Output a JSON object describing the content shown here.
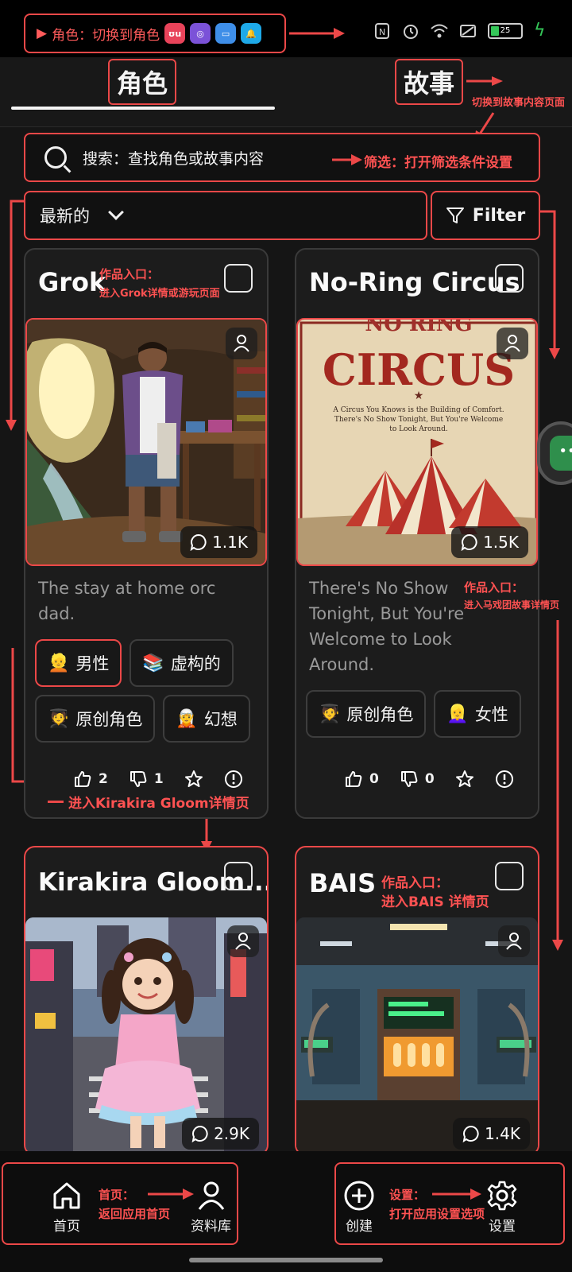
{
  "status_bar": {
    "annotation": "角色：切换到角色",
    "battery_level": "25",
    "colors": {
      "annotation_red": "#ec4848",
      "battery_green": "#35c759"
    },
    "mini_apps": [
      {
        "icon": "app-red-icon",
        "color": "#e8435a",
        "text": "ʊu"
      },
      {
        "icon": "app-purple-icon",
        "color": "#7b52d8",
        "text": "◎"
      },
      {
        "icon": "app-wallet-icon",
        "color": "#3e8ee8",
        "text": "▭"
      },
      {
        "icon": "qq-icon",
        "color": "#1ea9e8",
        "text": "🔔"
      }
    ]
  },
  "tabs": {
    "characters": "角色",
    "stories": "故事",
    "stories_annotation": "切换到故事内容页面"
  },
  "search": {
    "placeholder": "搜索：查找角色或故事内容",
    "annotation": "筛选：打开筛选条件设置"
  },
  "sort": {
    "selected": "最新的"
  },
  "filter": {
    "label": "Filter"
  },
  "cards": [
    {
      "title": "Grok",
      "annotation_line1": "作品入口：",
      "annotation_line2": "进入Grok详情或游玩页面",
      "count": "1.1K",
      "description": "The stay at home orc dad.",
      "tags": [
        {
          "emoji": "👱",
          "label": "男性"
        },
        {
          "emoji": "📚",
          "label": "虚构的"
        },
        {
          "emoji": "🧑‍🎓",
          "label": "原创角色"
        },
        {
          "emoji": "🧝",
          "label": "幻想"
        }
      ],
      "likes": "2",
      "dislikes": "1",
      "bottom_annotation": "进入Kirakira Gloom详情页"
    },
    {
      "title": "No-Ring Circus",
      "poster_title": "CIRCUS",
      "poster_subtitle": "A Circus You Knows is the Building of Comfort. There's No Show Tonight, But You're Welcome to Look Around.",
      "count": "1.5K",
      "description": "There's No Show Tonight, But You're Welcome to Look Around.",
      "tags": [
        {
          "emoji": "🧑‍🎓",
          "label": "原创角色"
        },
        {
          "emoji": "👱‍♀️",
          "label": "女性"
        }
      ],
      "likes": "0",
      "dislikes": "0",
      "annotation_line1": "作品入口：",
      "annotation_line2": "进入马戏团故事详情页"
    },
    {
      "title": "Kirakira Gloom...",
      "count": "2.9K"
    },
    {
      "title": "BAIS",
      "annotation_line1": "作品入口：",
      "annotation_line2": "进入BAIS 详情页",
      "count": "1.4K"
    }
  ],
  "bottom_nav": {
    "home": "首页",
    "library": "资料库",
    "create": "创建",
    "settings": "设置",
    "home_annotation_line1": "首页：",
    "home_annotation_line2": "返回应用首页",
    "settings_annotation_line1": "设置：",
    "settings_annotation_line2": "打开应用设置选项"
  }
}
